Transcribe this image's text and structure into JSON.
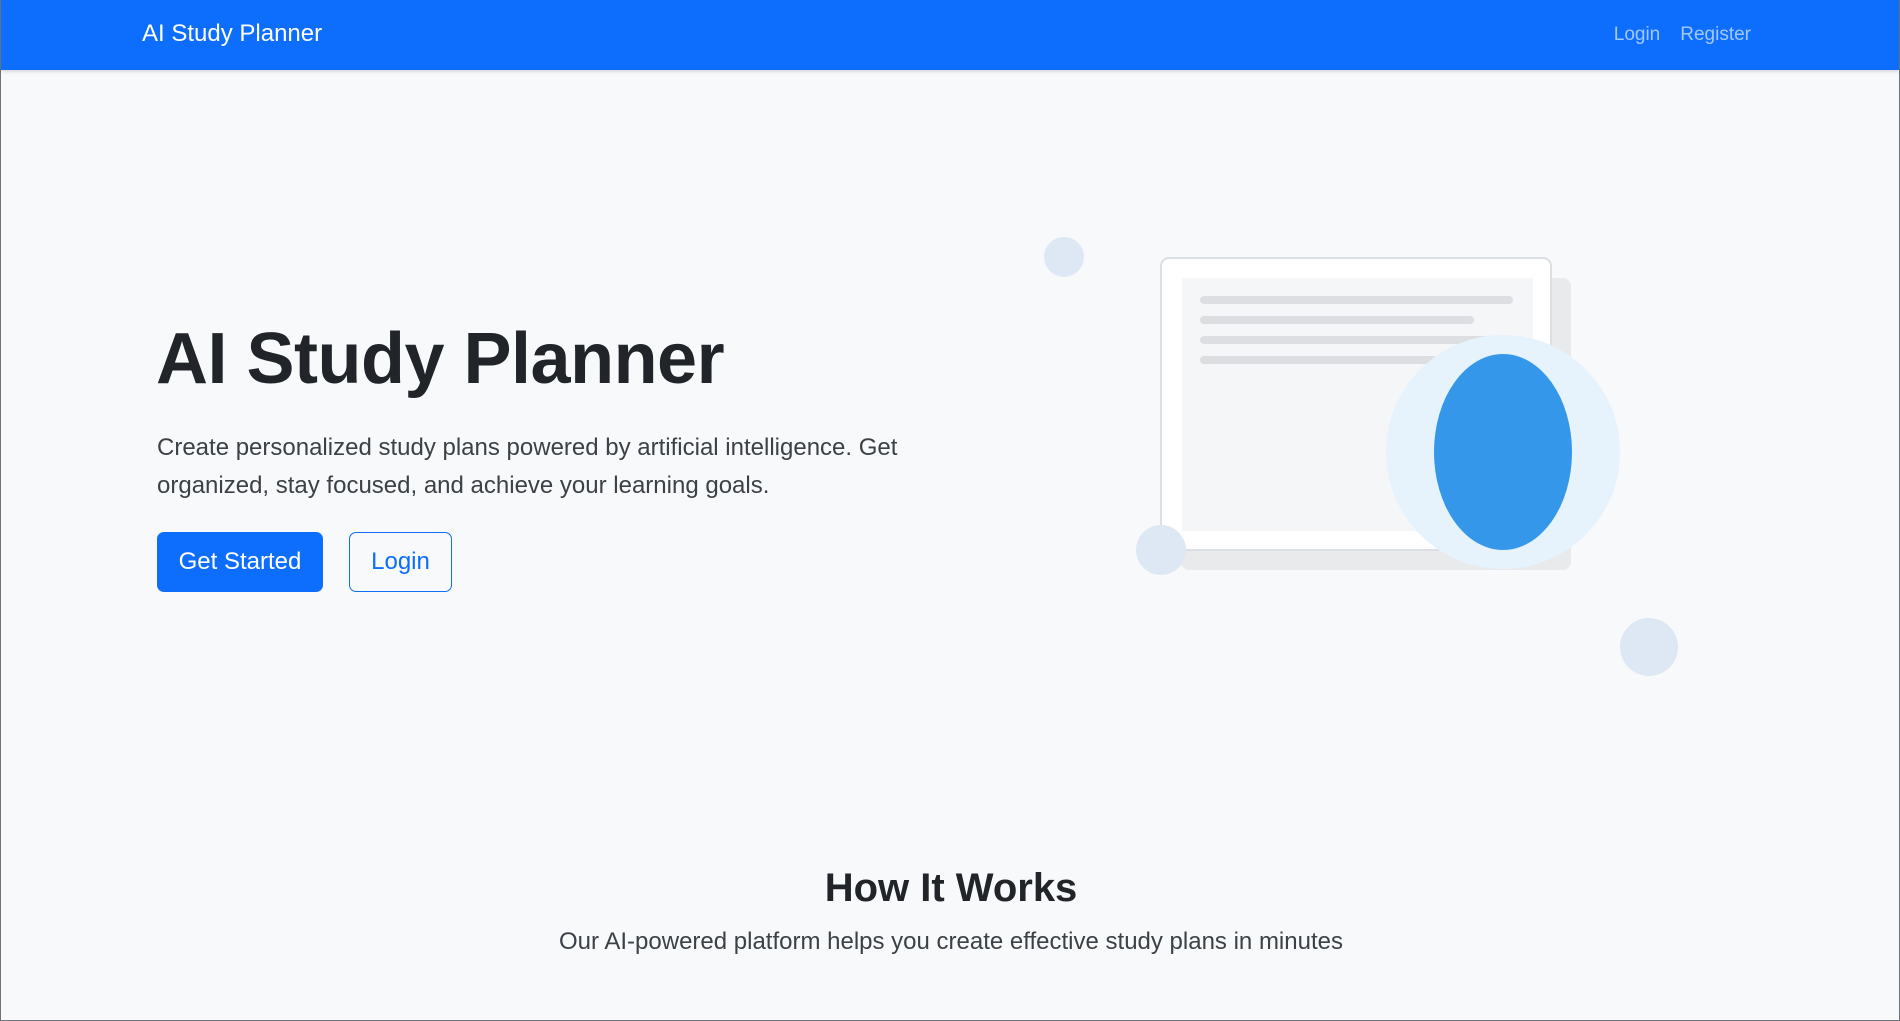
{
  "navbar": {
    "brand": "AI Study Planner",
    "links": [
      "Login",
      "Register"
    ]
  },
  "hero": {
    "title": "AI Study Planner",
    "lead": "Create personalized study plans powered by artificial intelligence. Get organized, stay focused, and achieve your learning goals.",
    "primary_button": "Get Started",
    "secondary_button": "Login"
  },
  "section": {
    "title": "How It Works",
    "subtitle": "Our AI-powered platform helps you create effective study plans in minutes"
  },
  "colors": {
    "primary": "#0d6efd",
    "background": "#f8f9fa",
    "text": "#212529",
    "accent_blue": "#3597ea"
  }
}
